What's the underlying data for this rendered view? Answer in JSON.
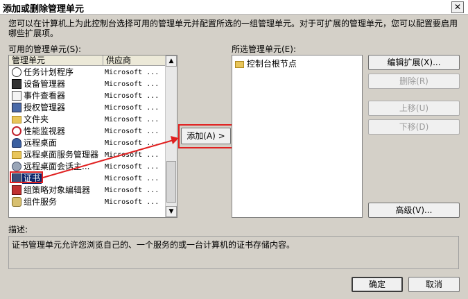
{
  "window": {
    "title": "添加或删除管理单元",
    "close": "✕"
  },
  "intro": "您可以在计算机上为此控制台选择可用的管理单元并配置所选的一组管理单元。对于可扩展的管理单元，您可以配置要启用哪些扩展项。",
  "available": {
    "label": "可用的管理单元(S):",
    "columns": [
      "管理单元",
      "供应商"
    ],
    "items": [
      {
        "name": "任务计划程序",
        "vendor": "Microsoft ...",
        "icon": "clock-icon"
      },
      {
        "name": "设备管理器",
        "vendor": "Microsoft ...",
        "icon": "device-manager-icon"
      },
      {
        "name": "事件查看器",
        "vendor": "Microsoft ...",
        "icon": "event-viewer-icon"
      },
      {
        "name": "授权管理器",
        "vendor": "Microsoft ...",
        "icon": "authorization-icon"
      },
      {
        "name": "文件夹",
        "vendor": "Microsoft ...",
        "icon": "folder-icon"
      },
      {
        "name": "性能监视器",
        "vendor": "Microsoft ...",
        "icon": "performance-icon"
      },
      {
        "name": "远程桌面",
        "vendor": "Microsoft ...",
        "icon": "remote-desktop-icon"
      },
      {
        "name": "远程桌面服务管理器",
        "vendor": "Microsoft ...",
        "icon": "folder-icon"
      },
      {
        "name": "远程桌面会话主...",
        "vendor": "Microsoft ...",
        "icon": "session-host-icon"
      },
      {
        "name": "证书",
        "vendor": "Microsoft ...",
        "icon": "certificate-icon",
        "selected": true
      },
      {
        "name": "组策略对象编辑器",
        "vendor": "Microsoft ...",
        "icon": "group-policy-icon"
      },
      {
        "name": "组件服务",
        "vendor": "Microsoft ...",
        "icon": "component-services-icon"
      }
    ]
  },
  "add_button": "添加(A) >",
  "selected": {
    "label": "所选管理单元(E):",
    "items": [
      {
        "name": "控制台根节点",
        "icon": "folder-icon"
      }
    ]
  },
  "side_buttons": {
    "edit_ext": "编辑扩展(X)...",
    "remove": "删除(R)",
    "move_up": "上移(U)",
    "move_down": "下移(D)",
    "advanced": "高级(V)..."
  },
  "description": {
    "label": "描述:",
    "text": "证书管理单元允许您浏览自己的、一个服务的或一台计算机的证书存储内容。"
  },
  "footer": {
    "ok": "确定",
    "cancel": "取消"
  },
  "colors": {
    "dialog_bg": "#d4d0c8",
    "selection": "#0a246a",
    "annotation_red": "#e02020"
  }
}
